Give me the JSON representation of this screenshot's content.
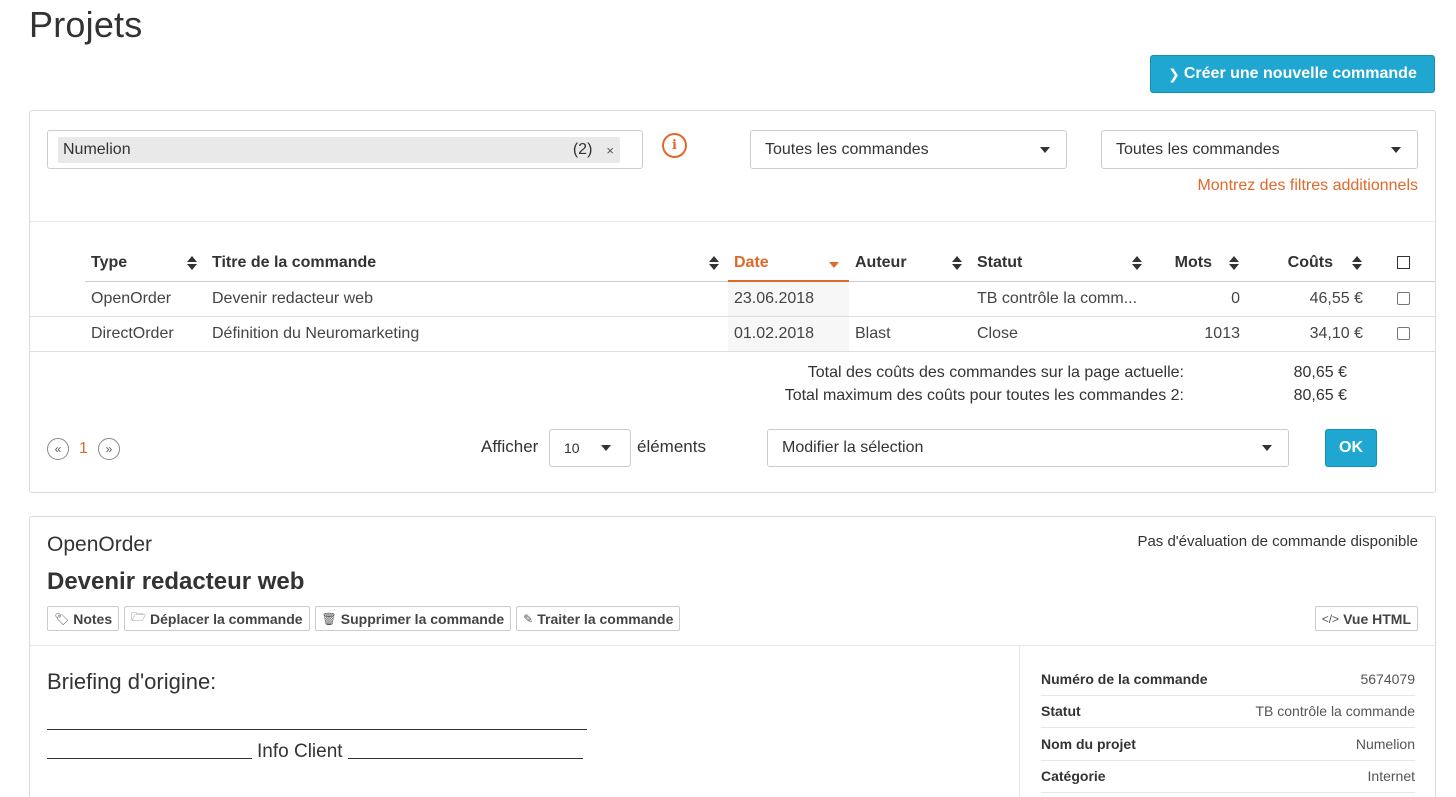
{
  "page": {
    "title": "Projets"
  },
  "actions": {
    "create_order": "Créer une nouvelle commande"
  },
  "filters": {
    "project_tag": {
      "label": "Numelion",
      "count": "(2)",
      "remove": "×"
    },
    "info": "i",
    "select1": "Toutes les commandes",
    "select2": "Toutes les commandes",
    "more_filters": "Montrez des filtres additionnels"
  },
  "table": {
    "headers": {
      "type": "Type",
      "title": "Titre de la commande",
      "date": "Date",
      "author": "Auteur",
      "status": "Statut",
      "words": "Mots",
      "cost": "Coûts"
    },
    "rows": [
      {
        "type": "OpenOrder",
        "title": "Devenir redacteur web",
        "date": "23.06.2018",
        "author": "",
        "status": "TB contrôle la comm...",
        "words": "0",
        "cost": "46,55 €"
      },
      {
        "type": "DirectOrder",
        "title": "Définition du Neuromarketing",
        "date": "01.02.2018",
        "author": "Blast",
        "status": "Close",
        "words": "1013",
        "cost": "34,10 €"
      }
    ]
  },
  "totals": {
    "page_label": "Total des coûts des commandes sur la page actuelle:",
    "page_value": "80,65 €",
    "max_label": "Total maximum des coûts pour toutes les commandes 2:",
    "max_value": "80,65 €"
  },
  "pagination": {
    "prev": "«",
    "current": "1",
    "next": "»"
  },
  "page_size": {
    "show_label": "Afficher",
    "value": "10",
    "items_label": "éléments"
  },
  "bulk": {
    "select": "Modifier la sélection",
    "ok": "OK"
  },
  "detail": {
    "type": "OpenOrder",
    "evaluation": "Pas d'évaluation de commande disponible",
    "title": "Devenir redacteur web",
    "buttons": {
      "notes": "Notes",
      "move": "Déplacer la commande",
      "delete": "Supprimer la commande",
      "process": "Traiter la commande",
      "html_view": "Vue HTML"
    },
    "briefing_title": "Briefing d'origine:",
    "briefing_client": "Info Client",
    "meta": [
      {
        "key": "Numéro de la commande",
        "value": "5674079"
      },
      {
        "key": "Statut",
        "value": "TB contrôle la commande"
      },
      {
        "key": "Nom du projet",
        "value": "Numelion"
      },
      {
        "key": "Catégorie",
        "value": "Internet"
      }
    ]
  },
  "colors": {
    "accent": "#1fa7d1",
    "orange": "#e0692a"
  }
}
